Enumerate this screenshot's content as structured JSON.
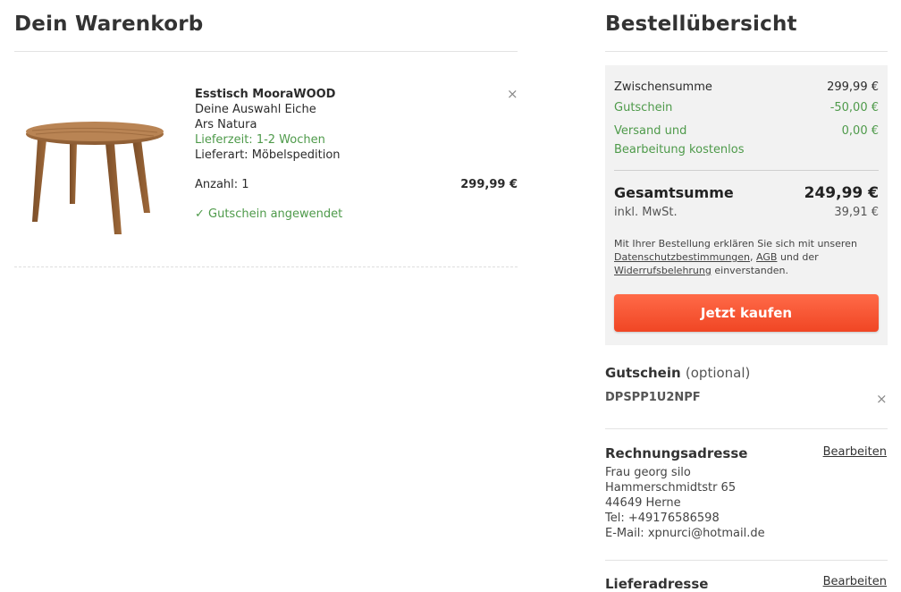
{
  "cart": {
    "title": "Dein Warenkorb",
    "item": {
      "name": "Esstisch MooraWOOD",
      "variant": "Deine Auswahl Eiche",
      "brand": "Ars Natura",
      "delivery_time": "Lieferzeit: 1-2 Wochen",
      "delivery_type": "Lieferart: Möbelspedition",
      "quantity": "Anzahl: 1",
      "price": "299,99 €",
      "voucher_note": "✓ Gutschein angewendet",
      "remove_icon": "×"
    }
  },
  "summary": {
    "title": "Bestellübersicht",
    "subtotal_label": "Zwischensumme",
    "subtotal_value": "299,99 €",
    "voucher_label": "Gutschein",
    "voucher_value": "-50,00 €",
    "shipping_label_1": "Versand und",
    "shipping_label_2": "Bearbeitung kostenlos",
    "shipping_value": "0,00 €",
    "total_label": "Gesamtsumme",
    "total_value": "249,99 €",
    "vat_label": "inkl. MwSt.",
    "vat_value": "39,91 €",
    "legal_prefix": "Mit Ihrer Bestellung erklären Sie sich mit unseren",
    "legal_privacy": "Datenschutzbestimmungen",
    "legal_agb": "AGB",
    "legal_and": "und der",
    "legal_withdrawal": "Widerrufsbelehrung",
    "legal_suffix": "einverstanden.",
    "buy_button": "Jetzt kaufen"
  },
  "voucher": {
    "title": "Gutschein",
    "optional": "(optional)",
    "code": "DPSPP1U2NPF",
    "remove_icon": "×"
  },
  "billing": {
    "title": "Rechnungsadresse",
    "edit": "Bearbeiten",
    "name": "Frau georg silo",
    "street": "Hammerschmidtstr 65",
    "city": "44649 Herne",
    "phone": "Tel: +49176586598",
    "email": "E-Mail: xpnurci@hotmail.de"
  },
  "shipping_address": {
    "title": "Lieferadresse",
    "edit": "Bearbeiten"
  },
  "colors": {
    "accent": "#f04624",
    "green": "#4e9a4a",
    "summary_bg": "#f2f2f2"
  }
}
